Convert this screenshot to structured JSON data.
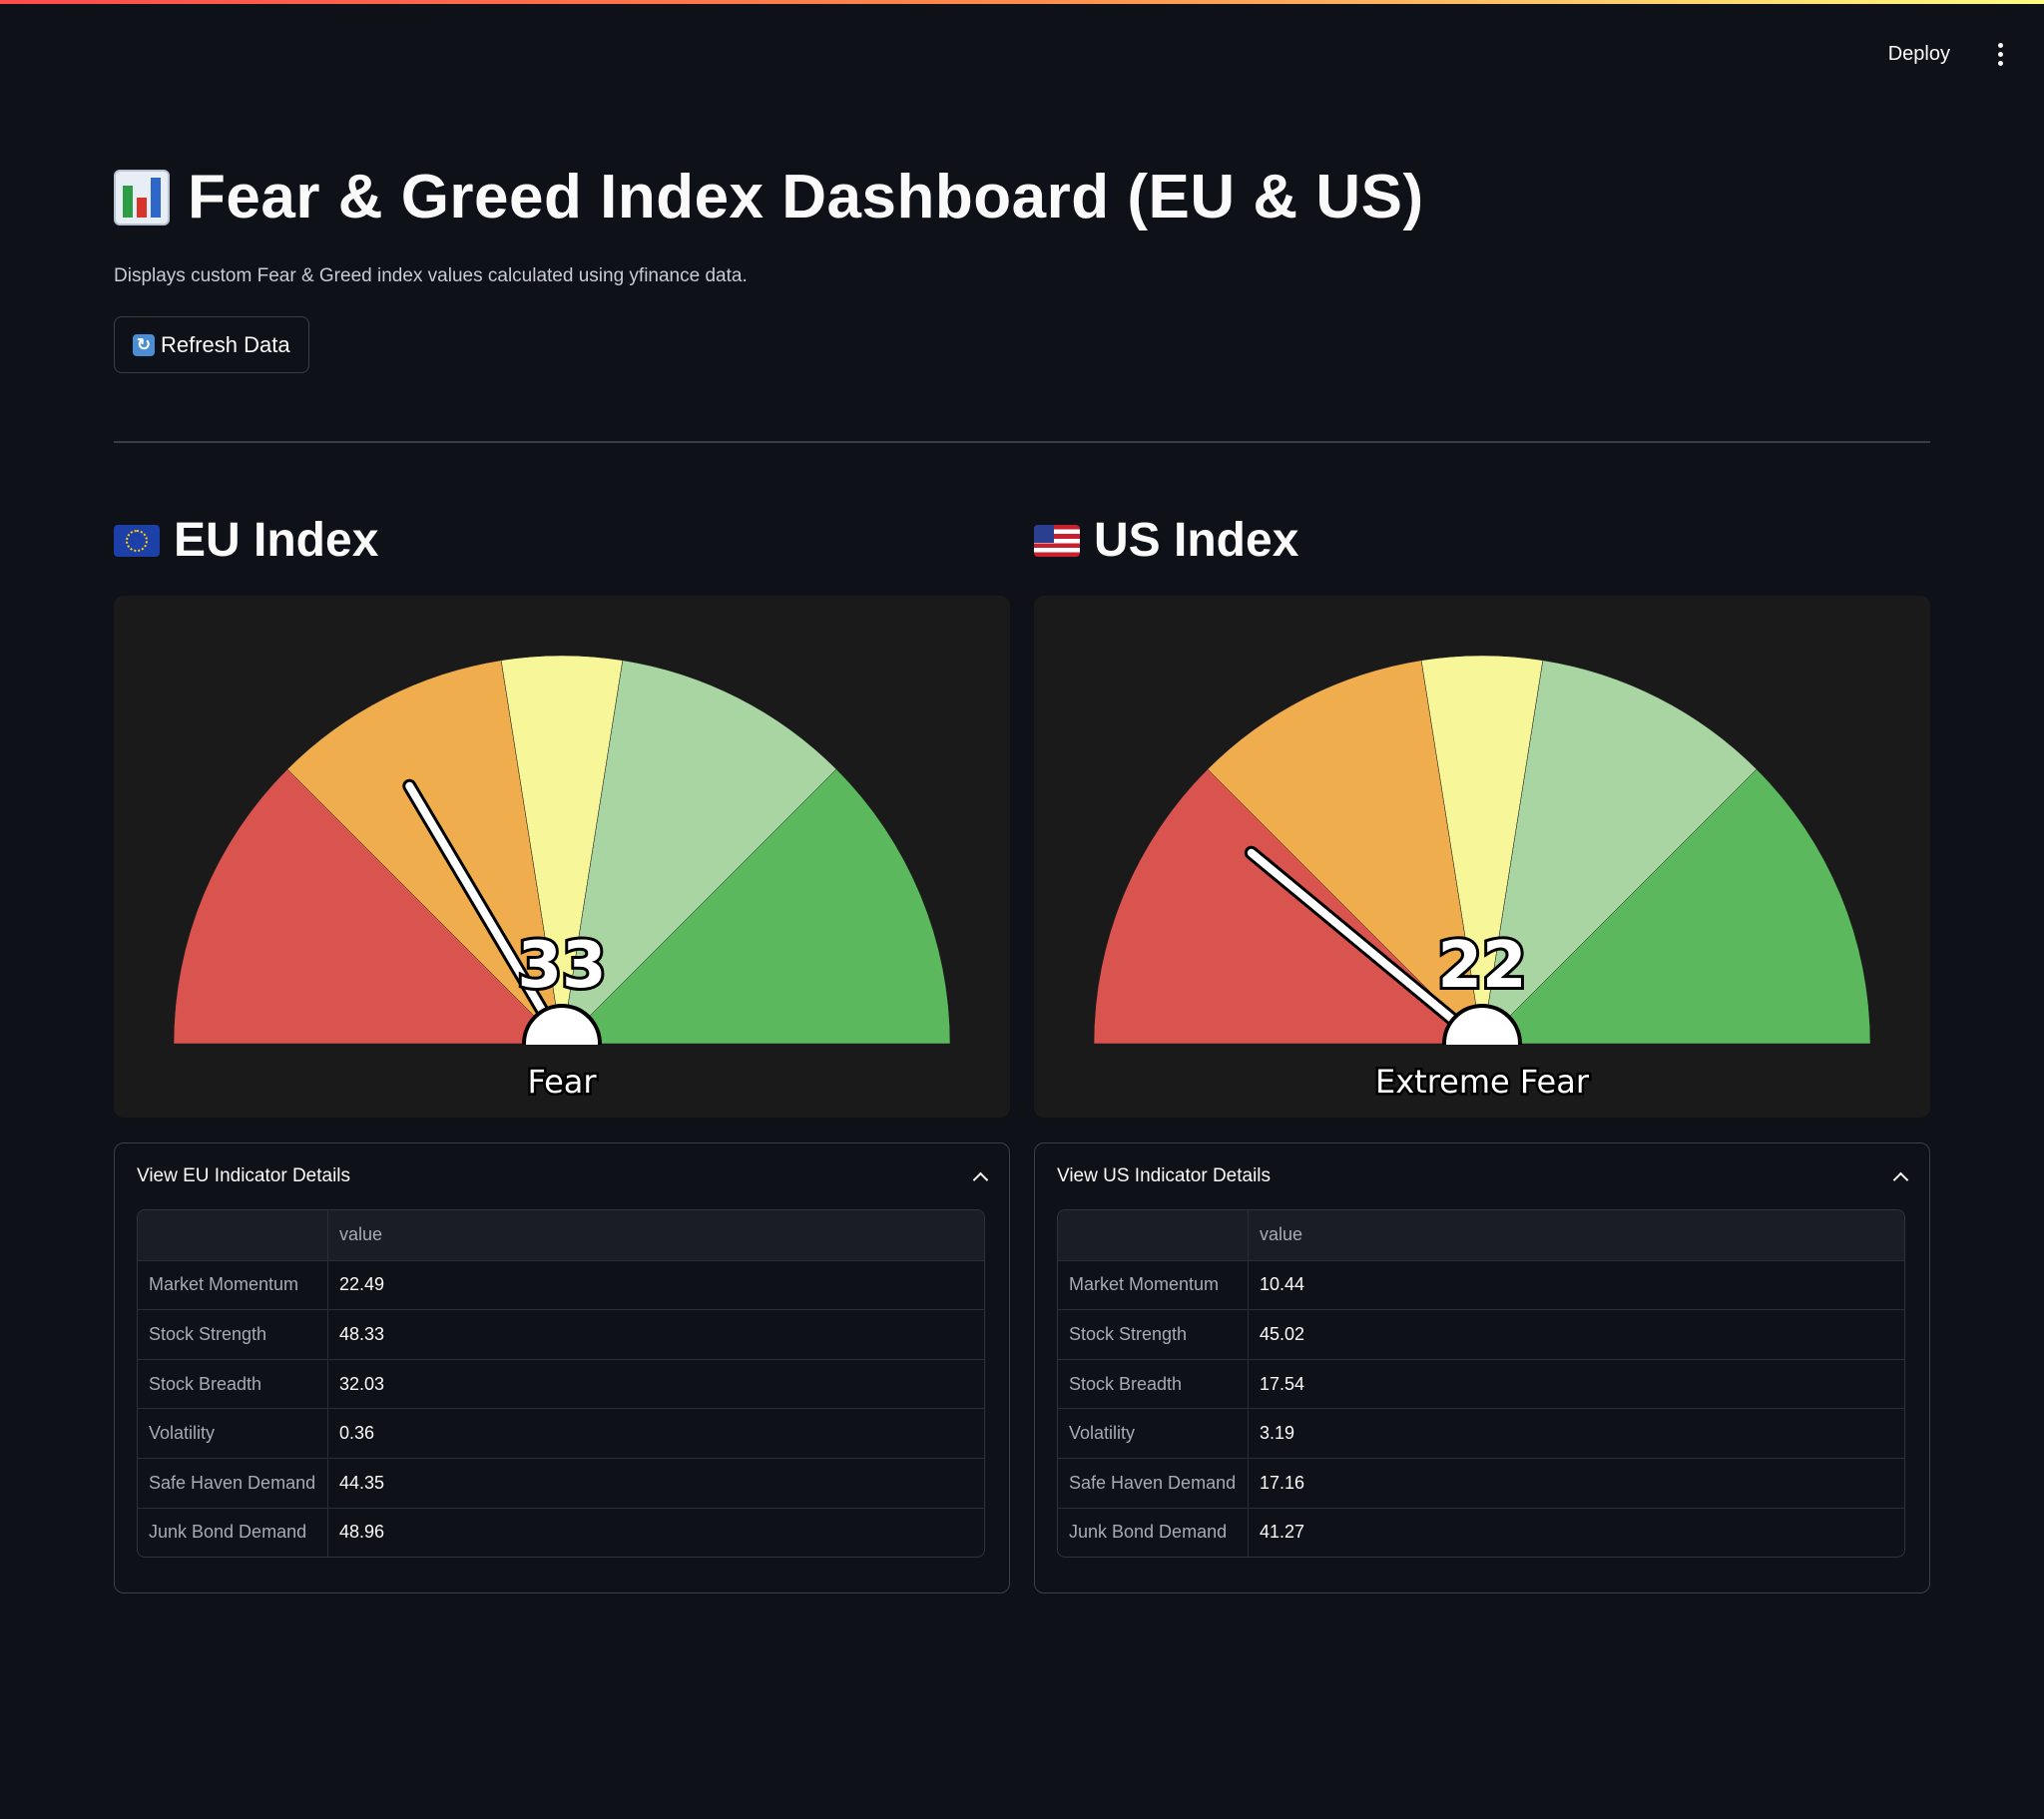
{
  "header": {
    "deploy_label": "Deploy"
  },
  "page": {
    "title": "Fear & Greed Index Dashboard (EU & US)",
    "subtitle": "Displays custom Fear & Greed index values calculated using yfinance data.",
    "refresh_label": "Refresh Data"
  },
  "eu": {
    "section_title": "EU Index",
    "gauge": {
      "value": 33,
      "value_text": "33",
      "label": "Fear"
    },
    "details_title": "View EU Indicator Details",
    "table": {
      "header": "value",
      "rows": [
        {
          "name": "Market Momentum",
          "value": "22.49"
        },
        {
          "name": "Stock Strength",
          "value": "48.33"
        },
        {
          "name": "Stock Breadth",
          "value": "32.03"
        },
        {
          "name": "Volatility",
          "value": "0.36"
        },
        {
          "name": "Safe Haven Demand",
          "value": "44.35"
        },
        {
          "name": "Junk Bond Demand",
          "value": "48.96"
        }
      ]
    }
  },
  "us": {
    "section_title": "US Index",
    "gauge": {
      "value": 22,
      "value_text": "22",
      "label": "Extreme Fear"
    },
    "details_title": "View US Indicator Details",
    "table": {
      "header": "value",
      "rows": [
        {
          "name": "Market Momentum",
          "value": "10.44"
        },
        {
          "name": "Stock Strength",
          "value": "45.02"
        },
        {
          "name": "Stock Breadth",
          "value": "17.54"
        },
        {
          "name": "Volatility",
          "value": "3.19"
        },
        {
          "name": "Safe Haven Demand",
          "value": "17.16"
        },
        {
          "name": "Junk Bond Demand",
          "value": "41.27"
        }
      ]
    }
  },
  "gauge_zones": [
    {
      "from": 0,
      "to": 25,
      "color": "#d9534f"
    },
    {
      "from": 25,
      "to": 45,
      "color": "#f0ad4e"
    },
    {
      "from": 45,
      "to": 55,
      "color": "#f7f799"
    },
    {
      "from": 55,
      "to": 75,
      "color": "#a8d5a2"
    },
    {
      "from": 75,
      "to": 100,
      "color": "#5cb85c"
    }
  ],
  "colors": {
    "background": "#0e1117",
    "card": "#1a1a1a",
    "accent_red": "#ff4b4b"
  },
  "icons": {
    "title": "bar-chart-icon",
    "refresh": "refresh-icon",
    "eu_flag": "eu-flag-icon",
    "us_flag": "us-flag-icon",
    "menu": "kebab-menu-icon",
    "collapse": "chevron-up-icon"
  }
}
